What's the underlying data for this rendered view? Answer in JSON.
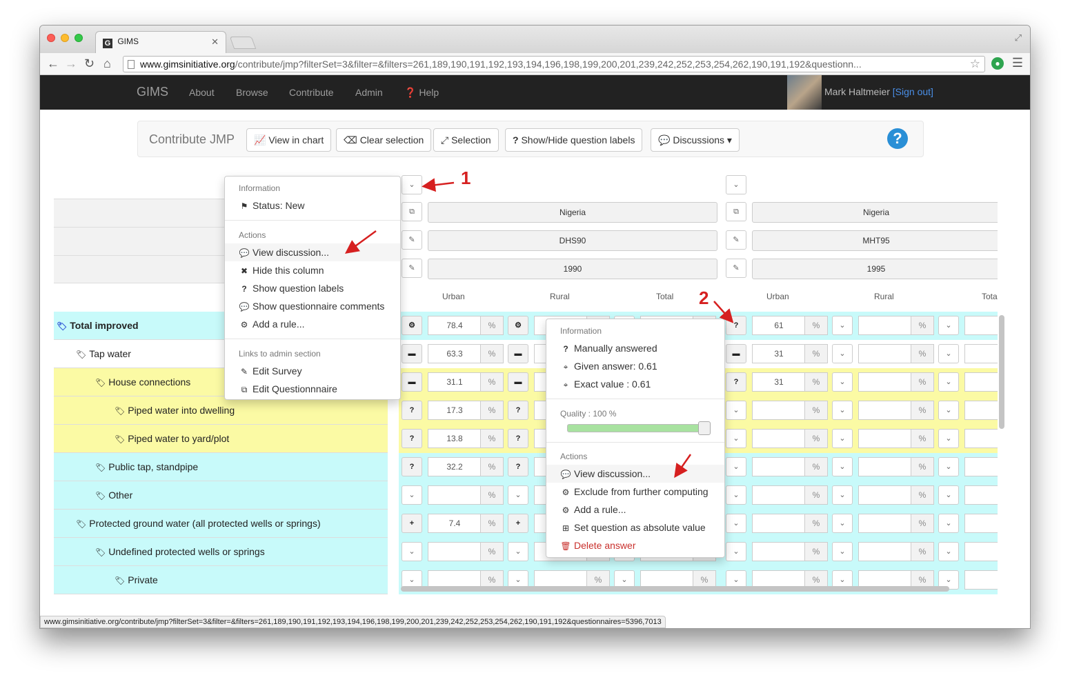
{
  "browser": {
    "tab_title": "GIMS",
    "tab_favicon": "G",
    "url_domain": "www.gimsinitiative.org",
    "url_path": "/contribute/jmp?filterSet=3&filter=&filters=261,189,190,191,192,193,194,196,198,199,200,201,239,242,252,253,254,262,190,191,192&questionn...",
    "status_url": "www.gimsinitiative.org/contribute/jmp?filterSet=3&filter=&filters=261,189,190,191,192,193,194,196,198,199,200,201,239,242,252,253,254,262,190,191,192&questionnaires=5396,7013"
  },
  "navbar": {
    "brand": "GIMS",
    "links": [
      "About",
      "Browse",
      "Contribute",
      "Admin",
      "Help"
    ],
    "user": "Mark Haltmeier",
    "signout": "[Sign out]"
  },
  "toolbar": {
    "title": "Contribute JMP",
    "view_chart": "View in chart",
    "clear_selection": "Clear selection",
    "selection": "Selection",
    "show_hide_labels": "Show/Hide question labels",
    "discussions": "Discussions"
  },
  "columns": [
    {
      "country": "Nigeria",
      "survey": "DHS90",
      "year": "1990"
    },
    {
      "country": "Nigeria",
      "survey": "MHT95",
      "year": "1995"
    }
  ],
  "subheaders": [
    "Urban",
    "Rural",
    "Total",
    "Urban",
    "Rural",
    "Tota"
  ],
  "rows": [
    {
      "label": "Total improved",
      "indent": 0,
      "color": "cyan",
      "c1_icon": "⚙",
      "c1_val": "78.4",
      "c2_icon": "?",
      "c2_val": "61"
    },
    {
      "label": "Tap water",
      "indent": 1,
      "color": "white",
      "c1_icon": "▬",
      "c1_val": "63.3",
      "c2_icon": "▬",
      "c2_val": "31"
    },
    {
      "label": "House connections",
      "indent": 2,
      "color": "yellow",
      "c1_icon": "▬",
      "c1_val": "31.1",
      "c2_icon": "?",
      "c2_val": "31"
    },
    {
      "label": "Piped water into dwelling",
      "indent": 3,
      "color": "yellow",
      "c1_icon": "?",
      "c1_val": "17.3",
      "c2_icon": "⌄",
      "c2_val": ""
    },
    {
      "label": "Piped water to yard/plot",
      "indent": 3,
      "color": "yellow",
      "c1_icon": "?",
      "c1_val": "13.8",
      "c2_icon": "⌄",
      "c2_val": ""
    },
    {
      "label": "Public tap, standpipe",
      "indent": 2,
      "color": "cyan",
      "c1_icon": "?",
      "c1_val": "32.2",
      "c2_icon": "⌄",
      "c2_val": ""
    },
    {
      "label": "Other",
      "indent": 2,
      "color": "cyan",
      "c1_icon": "⌄",
      "c1_val": "",
      "c2_icon": "⌄",
      "c2_val": ""
    },
    {
      "label": "Protected ground water (all protected wells or springs)",
      "indent": 1,
      "color": "cyan",
      "c1_icon": "+",
      "c1_val": "7.4",
      "c2_icon": "⌄",
      "c2_val": ""
    },
    {
      "label": "Undefined protected wells or springs",
      "indent": 2,
      "color": "cyan",
      "c1_icon": "⌄",
      "c1_val": "",
      "c2_icon": "⌄",
      "c2_val": ""
    },
    {
      "label": "Private",
      "indent": 3,
      "color": "cyan",
      "c1_icon": "⌄",
      "c1_val": "",
      "c2_icon": "⌄",
      "c2_val": ""
    }
  ],
  "percent": "%",
  "menu1": {
    "info_header": "Information",
    "status": "Status: New",
    "actions_header": "Actions",
    "view_discussion": "View discussion...",
    "hide_column": "Hide this column",
    "show_labels": "Show question labels",
    "show_comments": "Show questionnaire comments",
    "add_rule": "Add a rule...",
    "links_header": "Links to admin section",
    "edit_survey": "Edit Survey",
    "edit_questionnaire": "Edit Questionnnaire"
  },
  "menu2": {
    "info_header": "Information",
    "manually": "Manually answered",
    "given": "Given answer: 0.61",
    "exact": "Exact value : 0.61",
    "quality": "Quality : 100 %",
    "quality_value": 100,
    "actions_header": "Actions",
    "view_discussion": "View discussion...",
    "exclude": "Exclude from further computing",
    "add_rule": "Add a rule...",
    "set_absolute": "Set question as absolute value",
    "delete": "Delete answer"
  },
  "annotations": [
    "1",
    "2"
  ],
  "colors": {
    "cyan": "#c8fafa",
    "yellow": "#fbfaa4",
    "navbar": "#222222",
    "danger": "#c9302c",
    "arrow": "#d62020"
  }
}
